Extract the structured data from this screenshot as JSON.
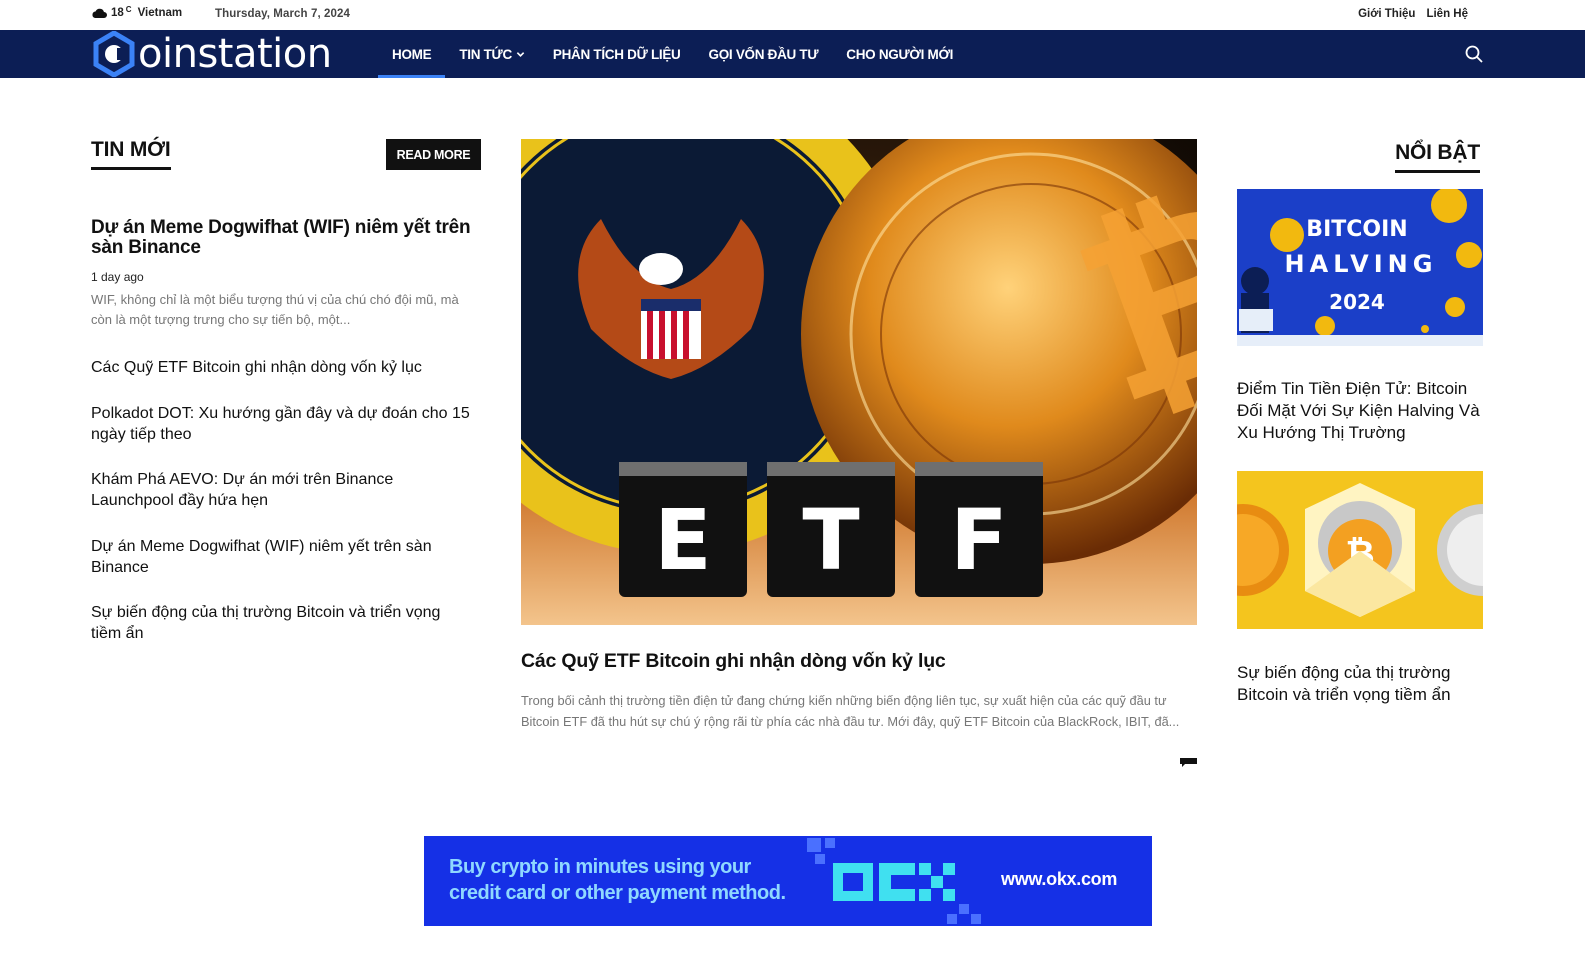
{
  "topbar": {
    "temperature": "18",
    "unit": "C",
    "location": "Vietnam",
    "date": "Thursday, March 7, 2024",
    "links": [
      "Giới Thiệu",
      "Liên Hệ"
    ]
  },
  "nav": {
    "logo_text": "oinstation",
    "items": [
      {
        "label": "HOME"
      },
      {
        "label": "TIN TỨC"
      },
      {
        "label": "PHÂN TÍCH DỮ LIỆU"
      },
      {
        "label": "GỌI VỐN ĐẦU TƯ"
      },
      {
        "label": "CHO NGƯỜI MỚI"
      }
    ]
  },
  "tin_moi": {
    "title": "TIN MỚI",
    "read_more": "READ MORE",
    "lead": {
      "title": "Dự án Meme Dogwifhat (WIF) niêm yết trên sàn Binance",
      "date": "1 day ago",
      "excerpt": "WIF, không chỉ là một biểu tượng thú vị của chú chó đội mũ, mà còn là một tượng trưng cho sự tiến bộ, một..."
    },
    "items": [
      "Các Quỹ ETF Bitcoin ghi nhận dòng vốn kỷ lục",
      "Polkadot DOT: Xu hướng gần đây và dự đoán cho 15 ngày tiếp theo",
      "Khám Phá AEVO: Dự án mới trên Binance Launchpool đầy hứa hẹn",
      "Dự án Meme Dogwifhat (WIF) niêm yết trên sàn Binance",
      "Sự biến động của thị trường Bitcoin và triển vọng tiềm ẩn"
    ]
  },
  "feature": {
    "image_text": "ETF",
    "title": "Các Quỹ ETF Bitcoin ghi nhận dòng vốn kỷ lục",
    "excerpt": "Trong bối cảnh thị trường tiền điện tử đang chứng kiến những biến động liên tục, sự xuất hiện của các quỹ đầu tư Bitcoin ETF đã thu hút sự chú ý rộng rãi từ phía các nhà đầu tư. Mới đây, quỹ ETF Bitcoin của BlackRock, IBIT, đã..."
  },
  "noi_bat": {
    "title": "NỔI BẬT",
    "cards": [
      {
        "image_text_1": "BITCOIN",
        "image_text_2": "HALVING",
        "image_text_3": "2024",
        "title": "Điểm Tin Tiền Điện Tử: Bitcoin Đối Mặt Với Sự Kiện Halving Và Xu Hướng Thị Trường"
      },
      {
        "title": "Sự biến động của thị trường Bitcoin và triển vọng tiềm ẩn"
      }
    ]
  },
  "ad": {
    "line1": "Buy crypto in minutes using your",
    "line2": "credit card or other payment method.",
    "url": "www.okx.com"
  },
  "colors": {
    "nav_bg": "#0c1e55",
    "accent": "#3b82f6",
    "ad_bg": "#1530e6"
  }
}
